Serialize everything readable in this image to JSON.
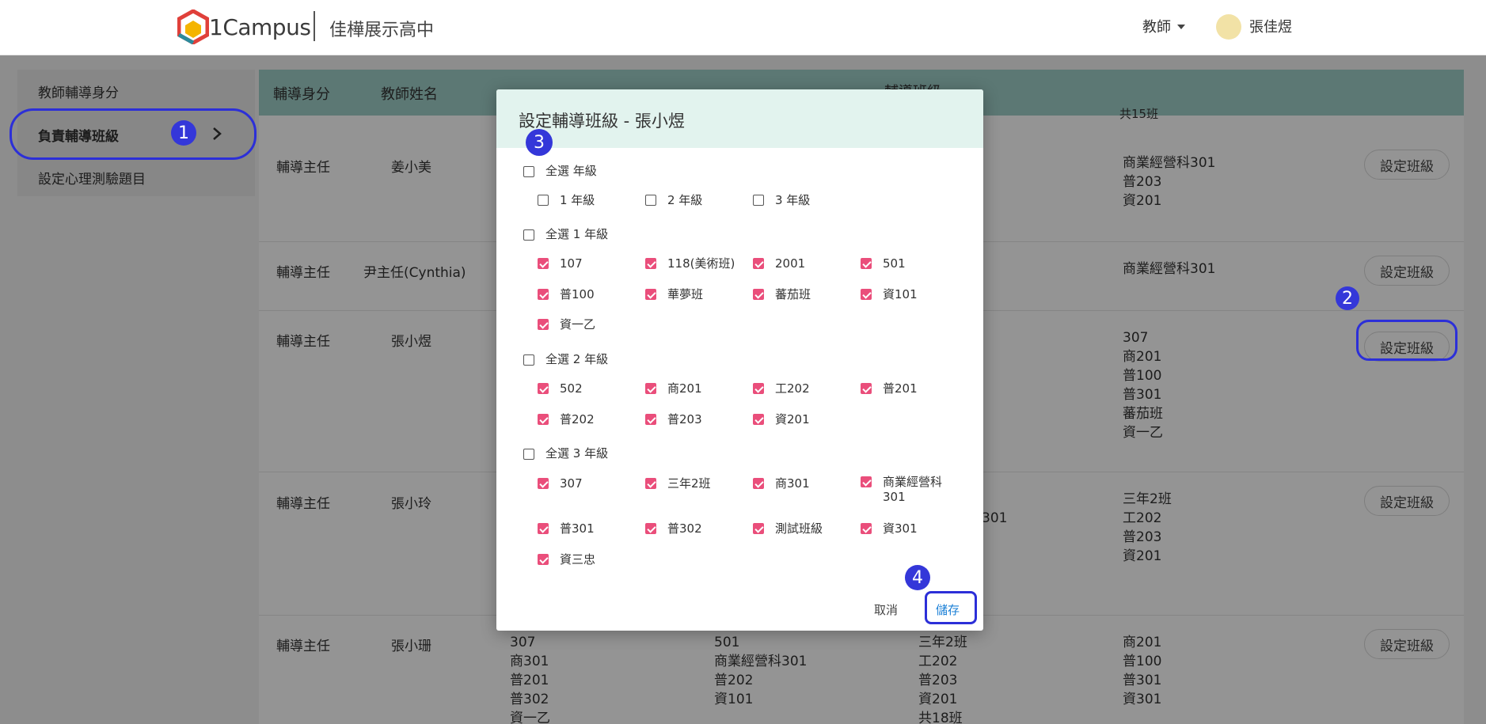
{
  "header": {
    "brand": "1Campus",
    "school": "佳樺展示高中",
    "role": "教師",
    "user": "張佳煜"
  },
  "sidebar": {
    "items": [
      {
        "label": "教師輔導身分"
      },
      {
        "label": "負責輔導班級"
      },
      {
        "label": "設定心理測驗題目"
      }
    ]
  },
  "table": {
    "headers": [
      "輔導身分",
      "教師姓名",
      "輔導班級"
    ],
    "top_fragment": "共15班",
    "button_label": "設定班級",
    "rows": [
      {
        "role": "輔導主任",
        "name": "姜小美",
        "classes": [
          "商業經營科301",
          "普203",
          "資201"
        ]
      },
      {
        "role": "輔導主任",
        "name": "尹主任(Cynthia)",
        "classes": [
          "商業經營科301"
        ]
      },
      {
        "role": "輔導主任",
        "name": "張小煜",
        "classes": [
          "307",
          "商201",
          "普100",
          "普301",
          "蕃茄班",
          "資一乙"
        ]
      },
      {
        "role": "輔導主任",
        "name": "張小玲",
        "mid_fragment": "301",
        "classes": [
          "三年2班",
          "工202",
          "普203",
          "資201"
        ]
      },
      {
        "role": "輔導主任",
        "name": "張小珊",
        "col1": [
          "307",
          "商301",
          "普201",
          "普302",
          "資一乙"
        ],
        "col2": [
          "501",
          "商業經營科301",
          "普202",
          "資101"
        ],
        "col3": [
          "三年2班",
          "工202",
          "普203",
          "資201",
          "共18班"
        ],
        "classes": [
          "商201",
          "普100",
          "普301",
          "資301"
        ]
      }
    ]
  },
  "callouts": [
    "1",
    "2",
    "3",
    "4"
  ],
  "modal": {
    "title": "設定輔導班級 - 張小煜",
    "select_all_grades": "全選 年級",
    "grades": [
      "1 年級",
      "2 年級",
      "3 年級"
    ],
    "groups": [
      {
        "label": "全選 1 年級",
        "items": [
          "107",
          "118(美術班)",
          "2001",
          "501",
          "普100",
          "華夢班",
          "蕃茄班",
          "資101",
          "資一乙"
        ]
      },
      {
        "label": "全選 2 年級",
        "items": [
          "502",
          "商201",
          "工202",
          "普201",
          "普202",
          "普203",
          "資201"
        ]
      },
      {
        "label": "全選 3 年級",
        "items": [
          "307",
          "三年2班",
          "商301",
          "商業經營科301",
          "普301",
          "普302",
          "測試班級",
          "資301",
          "資三忠"
        ]
      }
    ],
    "cancel": "取消",
    "save": "儲存"
  },
  "colors": {
    "accent": "#3437d9",
    "checkbox": "#ea4e7b",
    "header_bg": "#9fcfc9",
    "modal_head": "#e2f3ee",
    "save": "#1a7fd6"
  },
  "icons": [
    "campus-logo-icon",
    "caret-down-icon",
    "avatar-icon",
    "chevron-right-icon",
    "checkbox-icon"
  ]
}
